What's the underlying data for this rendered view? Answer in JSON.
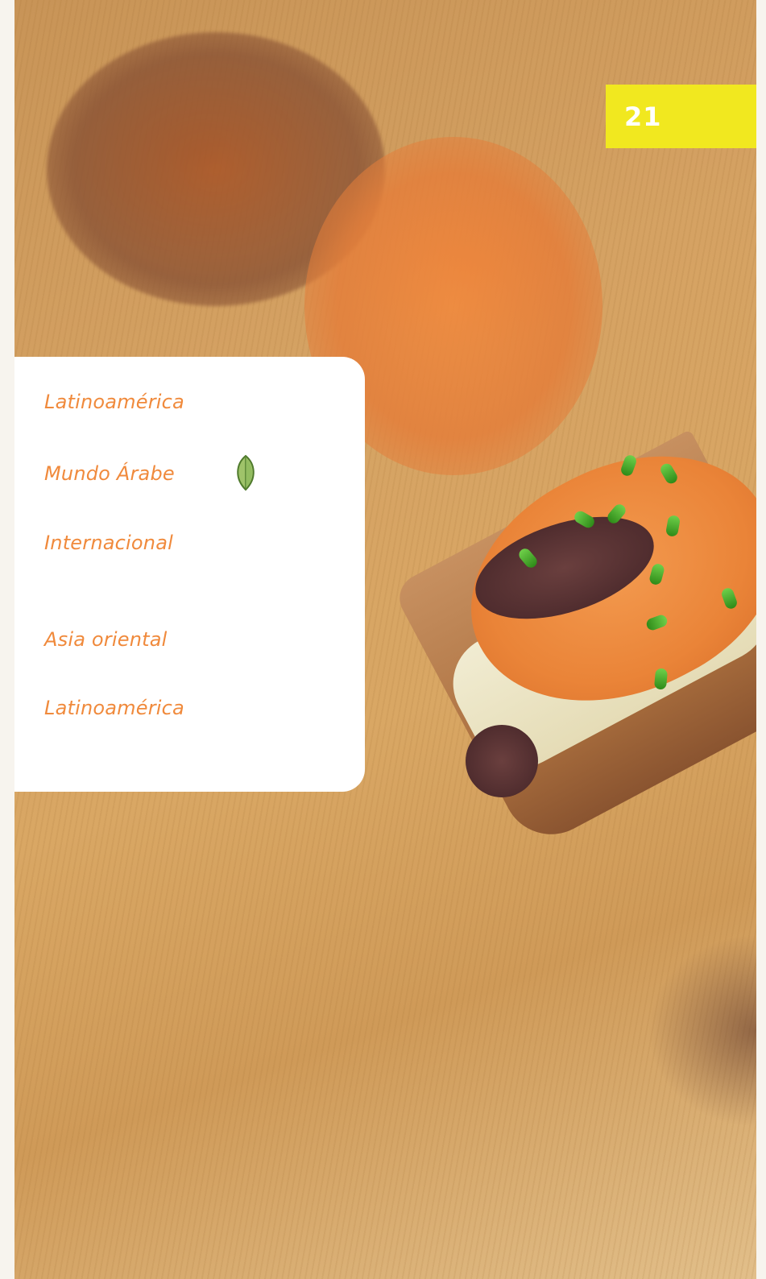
{
  "page": {
    "number": "21",
    "badge_color": "#f1e81f"
  },
  "menu": {
    "accent_color": "#f08a3c",
    "items": [
      {
        "label": "Latinoamérica"
      },
      {
        "label": "Mundo Árabe",
        "icon": "leaf-icon"
      },
      {
        "label": "Internacional"
      },
      {
        "label": "Asia oriental"
      },
      {
        "label": "Latinoamérica"
      }
    ]
  }
}
